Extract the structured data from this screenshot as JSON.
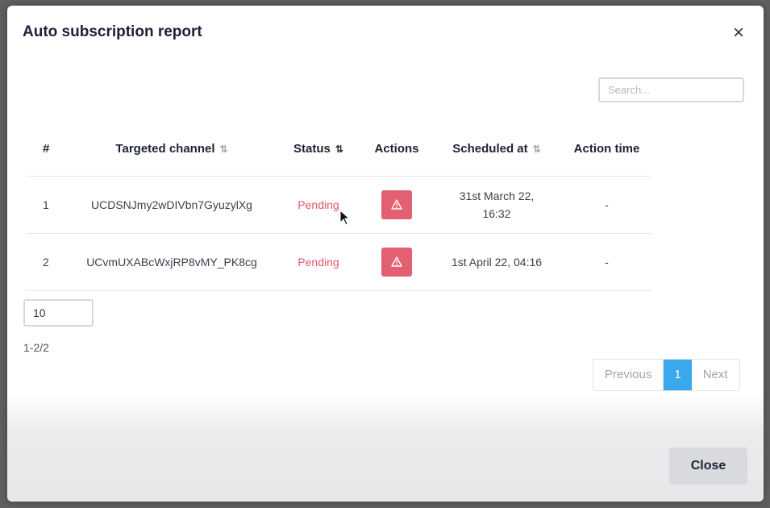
{
  "modal": {
    "title": "Auto subscription report",
    "close_icon": "close-icon"
  },
  "search": {
    "placeholder": "Search..."
  },
  "table": {
    "columns": [
      "#",
      "Targeted channel",
      "Status",
      "Actions",
      "Scheduled at",
      "Action time"
    ],
    "rows": [
      {
        "index": "1",
        "channel": "UCDSNJmy2wDIVbn7GyuzylXg",
        "status": "Pending",
        "action_icon": "warning-icon",
        "scheduled_line1": "31st March 22,",
        "scheduled_line2": "16:32",
        "action_time": "-"
      },
      {
        "index": "2",
        "channel": "UCvmUXABcWxjRP8vMY_PK8cg",
        "status": "Pending",
        "action_icon": "warning-icon",
        "scheduled_line1": "1st April 22, 04:16",
        "scheduled_line2": "",
        "action_time": "-"
      }
    ]
  },
  "page_size": "10",
  "range_text": "1-2/2",
  "pagination": {
    "previous": "Previous",
    "current": "1",
    "next": "Next"
  },
  "footer": {
    "close_label": "Close"
  },
  "colors": {
    "pending": "#e0546a",
    "danger_button": "#e35f72",
    "active_page": "#3aa8ec"
  }
}
